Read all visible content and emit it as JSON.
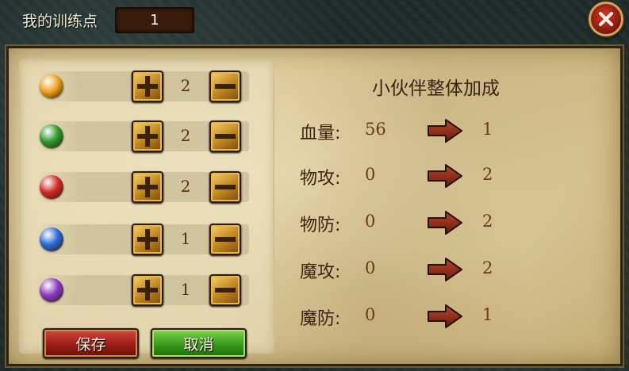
{
  "header": {
    "label": "我的训练点",
    "points": "1"
  },
  "stats": [
    {
      "icon": "sun-orb-icon",
      "color": "#f2a21c",
      "value": "2"
    },
    {
      "icon": "green-orb-icon",
      "color": "#2e9a2a",
      "value": "2"
    },
    {
      "icon": "red-orb-icon",
      "color": "#d22a24",
      "value": "2"
    },
    {
      "icon": "blue-orb-icon",
      "color": "#2a6ad6",
      "value": "1"
    },
    {
      "icon": "purple-orb-icon",
      "color": "#8a3ac2",
      "value": "1"
    }
  ],
  "buttons": {
    "save": "保存",
    "cancel": "取消"
  },
  "bonus": {
    "title": "小伙伴整体加成",
    "rows": [
      {
        "label": "血量:",
        "current": "56",
        "add": "1"
      },
      {
        "label": "物攻:",
        "current": "0",
        "add": "2"
      },
      {
        "label": "物防:",
        "current": "0",
        "add": "2"
      },
      {
        "label": "魔攻:",
        "current": "0",
        "add": "2"
      },
      {
        "label": "魔防:",
        "current": "0",
        "add": "1"
      }
    ]
  }
}
